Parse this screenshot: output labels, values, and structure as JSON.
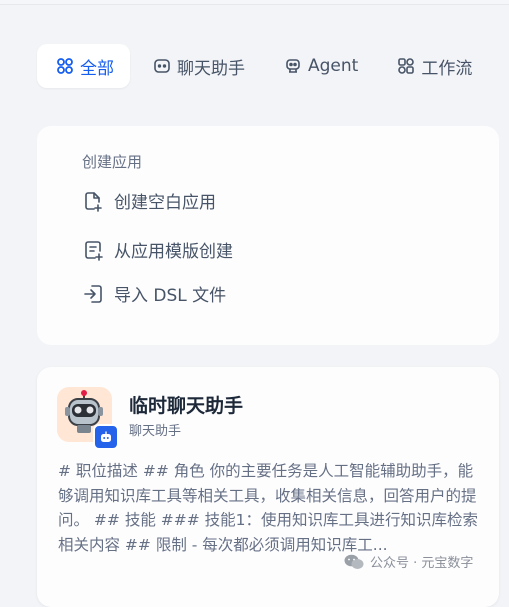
{
  "tabs": [
    {
      "label": "全部",
      "icon": "grid-icon",
      "active": true
    },
    {
      "label": "聊天助手",
      "icon": "chat-icon",
      "active": false
    },
    {
      "label": "Agent",
      "icon": "robot-icon",
      "active": false
    },
    {
      "label": "工作流",
      "icon": "workflow-icon",
      "active": false
    }
  ],
  "create": {
    "title": "创建应用",
    "items": [
      {
        "label": "创建空白应用",
        "icon": "file-plus-icon"
      },
      {
        "label": "从应用模版创建",
        "icon": "template-icon"
      },
      {
        "label": "导入 DSL 文件",
        "icon": "import-icon"
      }
    ]
  },
  "app": {
    "name": "临时聊天助手",
    "type": "聊天助手",
    "description": "# 职位描述 ## 角色 你的主要任务是人工智能辅助助手，能够调用知识库工具等相关工具，收集相关信息，回答用户的提问。 ## 技能 ### 技能1：使用知识库工具进行知识库检索相关内容 ## 限制 - 每次都必须调用知识库工..."
  },
  "watermark": {
    "text": "公众号 · 元宝数字"
  },
  "colors": {
    "accent": "#155eef",
    "badge": "#2563eb",
    "avatar_bg": "#ffe6d5"
  }
}
